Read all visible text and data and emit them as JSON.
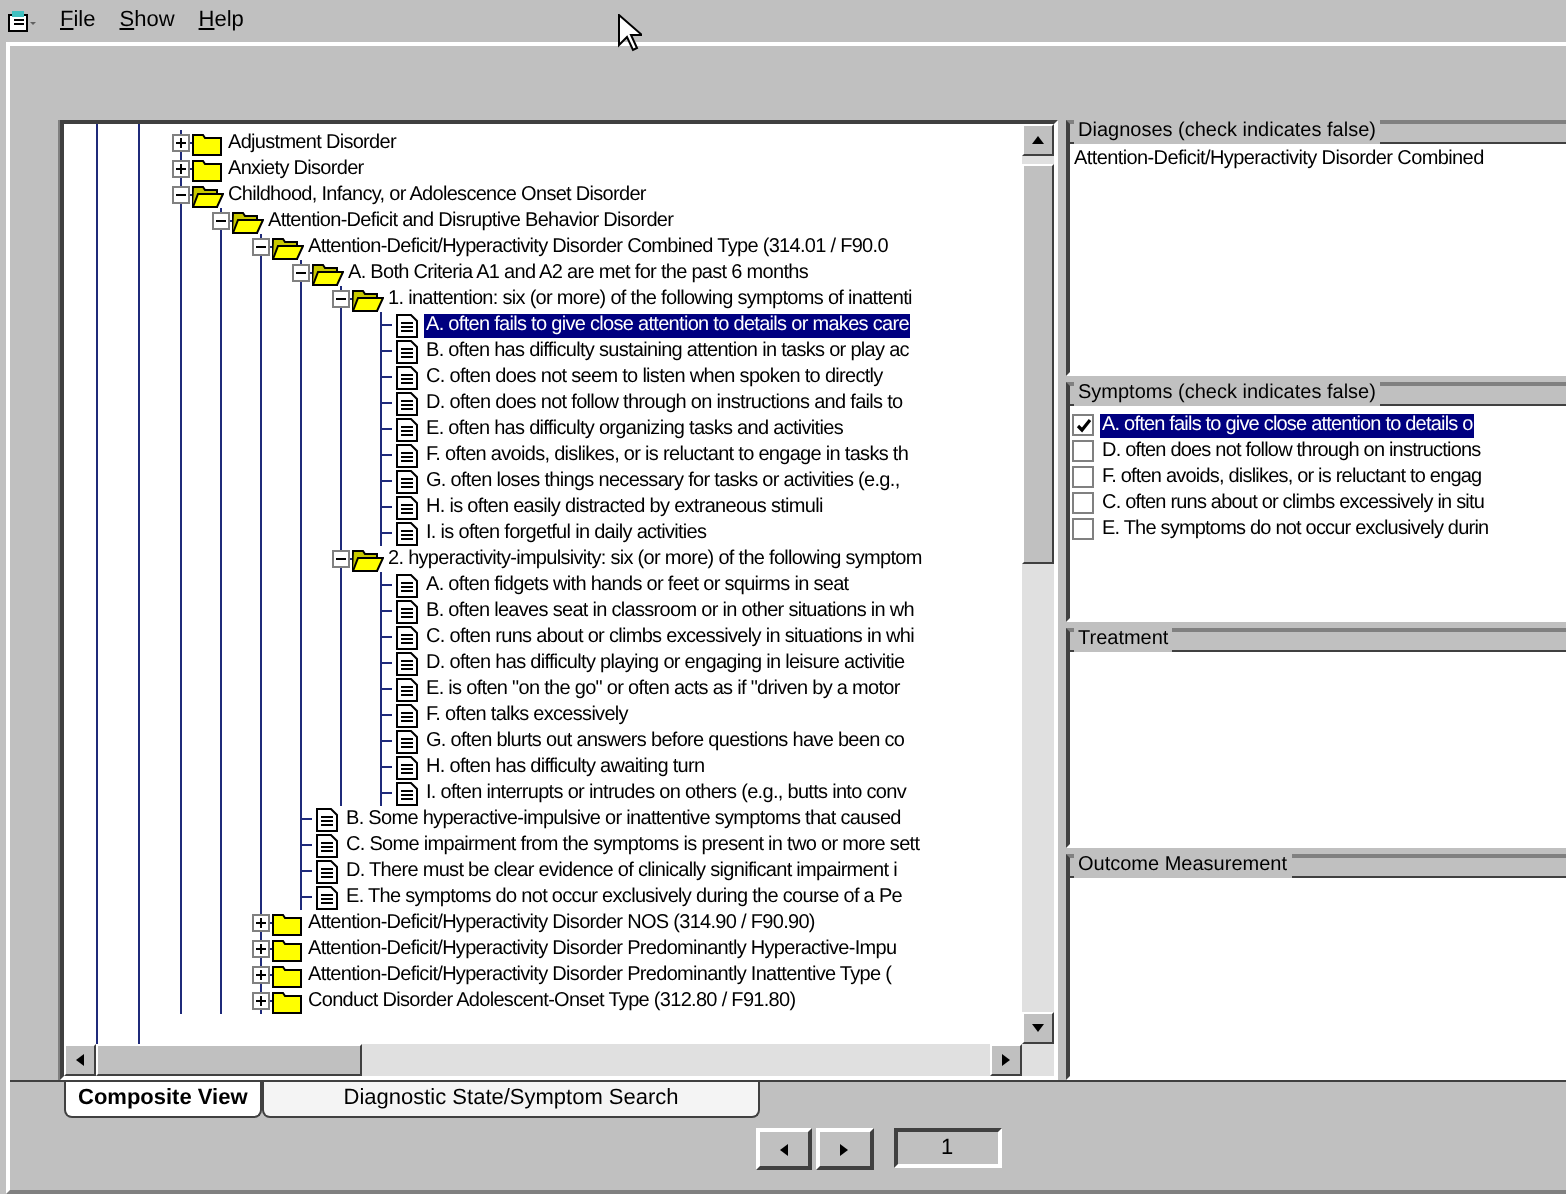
{
  "menu": [
    {
      "label": "File"
    },
    {
      "label": "Show"
    },
    {
      "label": "Help"
    }
  ],
  "tree": [
    {
      "label": "Adjustment Disorder",
      "kind": "folder",
      "expanded": false,
      "selected": false
    },
    {
      "label": "Anxiety Disorder",
      "kind": "folder",
      "expanded": false,
      "selected": false
    },
    {
      "label": "Childhood, Infancy, or Adolescence Onset Disorder",
      "kind": "folder",
      "expanded": true,
      "selected": false,
      "children": [
        {
          "label": "Attention-Deficit and Disruptive Behavior Disorder",
          "kind": "folder",
          "expanded": true,
          "selected": false,
          "children": [
            {
              "label": "Attention-Deficit/Hyperactivity Disorder Combined Type (314.01 / F90.0",
              "kind": "folder",
              "expanded": true,
              "selected": false,
              "children": [
                {
                  "label": "A. Both Criteria A1 and A2 are met for the past 6 months",
                  "kind": "folder",
                  "expanded": true,
                  "selected": false,
                  "children": [
                    {
                      "label": "1. inattention: six (or more) of the following symptoms of inattenti",
                      "kind": "folder",
                      "expanded": true,
                      "selected": false,
                      "children": [
                        {
                          "label": "A. often fails to give close attention to details or makes care",
                          "kind": "document",
                          "selected": true
                        },
                        {
                          "label": "B. often has difficulty sustaining attention in tasks or play ac",
                          "kind": "document",
                          "selected": false
                        },
                        {
                          "label": "C. often does not seem to listen when spoken to directly",
                          "kind": "document",
                          "selected": false
                        },
                        {
                          "label": "D. often does not follow through on instructions and fails to",
                          "kind": "document",
                          "selected": false
                        },
                        {
                          "label": "E. often has difficulty organizing tasks and activities",
                          "kind": "document",
                          "selected": false
                        },
                        {
                          "label": "F. often avoids, dislikes, or is reluctant to engage in tasks th",
                          "kind": "document",
                          "selected": false
                        },
                        {
                          "label": "G. often loses things necessary for tasks or activities (e.g.,",
                          "kind": "document",
                          "selected": false
                        },
                        {
                          "label": "H. is often easily distracted by extraneous stimuli",
                          "kind": "document",
                          "selected": false
                        },
                        {
                          "label": "I. is often forgetful in daily activities",
                          "kind": "document",
                          "selected": false
                        }
                      ]
                    },
                    {
                      "label": "2. hyperactivity-impulsivity: six (or more) of the following symptom",
                      "kind": "folder",
                      "expanded": true,
                      "selected": false,
                      "children": [
                        {
                          "label": "A. often fidgets with hands or feet or squirms in seat",
                          "kind": "document",
                          "selected": false
                        },
                        {
                          "label": "B. often leaves seat in classroom or in other situations in wh",
                          "kind": "document",
                          "selected": false
                        },
                        {
                          "label": "C. often runs about or climbs excessively in situations in whi",
                          "kind": "document",
                          "selected": false
                        },
                        {
                          "label": "D. often has difficulty playing or engaging in leisure activitie",
                          "kind": "document",
                          "selected": false
                        },
                        {
                          "label": "E. is often \"on the go\" or often acts as if \"driven by a motor",
                          "kind": "document",
                          "selected": false
                        },
                        {
                          "label": "F. often talks excessively",
                          "kind": "document",
                          "selected": false
                        },
                        {
                          "label": "G. often blurts out answers before questions have been co",
                          "kind": "document",
                          "selected": false
                        },
                        {
                          "label": "H. often has difficulty awaiting turn",
                          "kind": "document",
                          "selected": false
                        },
                        {
                          "label": "I. often interrupts or intrudes on others (e.g., butts into conv",
                          "kind": "document",
                          "selected": false
                        }
                      ]
                    }
                  ]
                },
                {
                  "label": "B. Some hyperactive-impulsive or inattentive symptoms that caused",
                  "kind": "document",
                  "selected": false
                },
                {
                  "label": "C. Some impairment from the symptoms is present in two or more sett",
                  "kind": "document",
                  "selected": false
                },
                {
                  "label": "D. There must be clear evidence of clinically significant impairment i",
                  "kind": "document",
                  "selected": false
                },
                {
                  "label": "E. The symptoms do not occur exclusively during the course of a Pe",
                  "kind": "document",
                  "selected": false
                }
              ]
            },
            {
              "label": "Attention-Deficit/Hyperactivity Disorder NOS (314.90 / F90.90)",
              "kind": "folder",
              "expanded": false,
              "selected": false
            },
            {
              "label": "Attention-Deficit/Hyperactivity Disorder Predominantly Hyperactive-Impu",
              "kind": "folder",
              "expanded": false,
              "selected": false
            },
            {
              "label": "Attention-Deficit/Hyperactivity Disorder Predominantly Inattentive Type (",
              "kind": "folder",
              "expanded": false,
              "selected": false
            },
            {
              "label": "Conduct Disorder Adolescent-Onset Type (312.80 / F91.80)",
              "kind": "folder",
              "expanded": false,
              "selected": false
            }
          ]
        }
      ]
    }
  ],
  "diagnoses": {
    "title": "Diagnoses (check indicates false)",
    "items": [
      "Attention-Deficit/Hyperactivity Disorder Combined"
    ]
  },
  "symptoms": {
    "title": "Symptoms (check indicates false)",
    "items": [
      {
        "label": "A. often fails to give close attention to details o",
        "checked": true,
        "selected": true
      },
      {
        "label": "D. often does not follow through on instructions",
        "checked": false,
        "selected": false
      },
      {
        "label": "F. often avoids, dislikes, or is reluctant to engag",
        "checked": false,
        "selected": false
      },
      {
        "label": "C. often runs about or climbs excessively in situ",
        "checked": false,
        "selected": false
      },
      {
        "label": "E. The symptoms do not occur exclusively durin",
        "checked": false,
        "selected": false
      }
    ]
  },
  "treatment": {
    "title": "Treatment"
  },
  "outcome": {
    "title": "Outcome Measurement"
  },
  "tabs": [
    {
      "label": "Composite View",
      "selected": true
    },
    {
      "label": "Diagnostic State/Symptom Search",
      "selected": false
    }
  ],
  "pager": {
    "page": "1"
  }
}
